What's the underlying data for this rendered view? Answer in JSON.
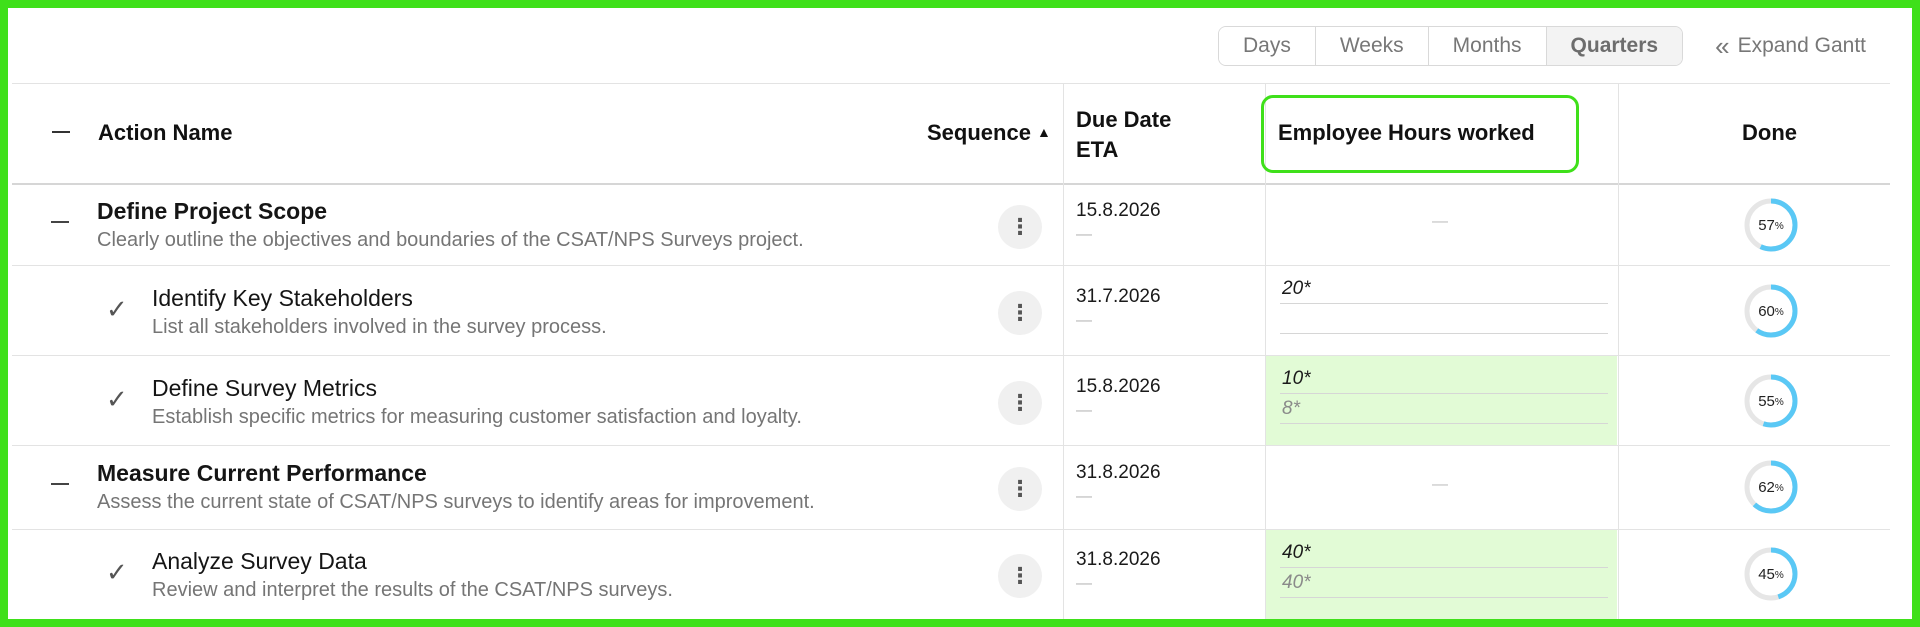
{
  "toolbar": {
    "scale_options": [
      "Days",
      "Weeks",
      "Months",
      "Quarters"
    ],
    "active_scale": "Quarters",
    "expand_label": "Expand Gantt"
  },
  "columns": {
    "action_name": "Action Name",
    "sequence": "Sequence",
    "sequence_sort_icon": "▲",
    "due_date_line1": "Due Date",
    "due_date_line2": "ETA",
    "hours": "Employee Hours worked",
    "done": "Done"
  },
  "colors": {
    "highlight": "#3fe01a",
    "progress": "#5ac8f5",
    "progress_track": "#e6e6e6",
    "hours_fill": "#e2fbd6"
  },
  "rows": [
    {
      "type": "parent",
      "title": "Define Project Scope",
      "description": "Clearly outline the objectives and boundaries of the CSAT/NPS Surveys project.",
      "due_date": "15.8.2026",
      "due_sub": "—",
      "hours_empty": "—",
      "hours": [],
      "done_pct": 57
    },
    {
      "type": "child",
      "title": "Identify Key Stakeholders",
      "description": "List all stakeholders involved in the survey process.",
      "due_date": "31.7.2026",
      "due_sub": "—",
      "hours": [
        "20*",
        ""
      ],
      "done_pct": 60
    },
    {
      "type": "child",
      "title": "Define Survey Metrics",
      "description": "Establish specific metrics for measuring customer satisfaction and loyalty.",
      "due_date": "15.8.2026",
      "due_sub": "—",
      "hours": [
        "10*",
        "8*"
      ],
      "done_pct": 55
    },
    {
      "type": "parent",
      "title": "Measure Current Performance",
      "description": "Assess the current state of CSAT/NPS surveys to identify areas for improvement.",
      "due_date": "31.8.2026",
      "due_sub": "—",
      "hours_empty": "—",
      "hours": [],
      "done_pct": 62
    },
    {
      "type": "child",
      "title": "Analyze Survey Data",
      "description": "Review and interpret the results of the CSAT/NPS surveys.",
      "due_date": "31.8.2026",
      "due_sub": "—",
      "hours": [
        "40*",
        "40*"
      ],
      "done_pct": 45
    }
  ],
  "icons": {
    "collapse": "minus-icon",
    "expand_gantt": "double-chevron-left-icon",
    "row_menu": "kebab-menu-icon",
    "child_status": "check-icon"
  }
}
